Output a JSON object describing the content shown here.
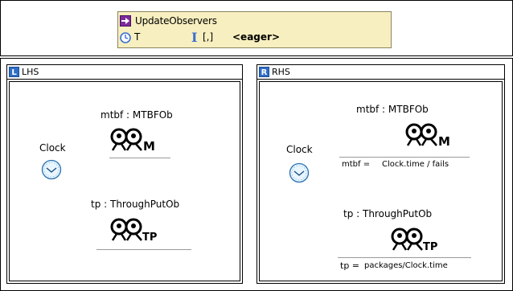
{
  "rule": {
    "name": "UpdateObservers",
    "priority": "T",
    "parameters": "[,]",
    "application_mode": "<eager>"
  },
  "lhs": {
    "badge": "L",
    "title": "LHS",
    "clock": {
      "label": "Clock"
    },
    "mtbf": {
      "label": "mtbf : MTBFOb",
      "icon_letter": "M"
    },
    "tp": {
      "label": "tp : ThroughPutOb",
      "icon_letter": "TP"
    }
  },
  "rhs": {
    "badge": "R",
    "title": "RHS",
    "clock": {
      "label": "Clock"
    },
    "mtbf": {
      "label": "mtbf : MTBFOb",
      "icon_letter": "M",
      "attr_name": "mtbf =",
      "attr_value": "Clock.time / fails"
    },
    "tp": {
      "label": "tp : ThroughPutOb",
      "icon_letter": "TP",
      "attr_name": "tp =",
      "attr_value": "packages/Clock.time"
    }
  }
}
